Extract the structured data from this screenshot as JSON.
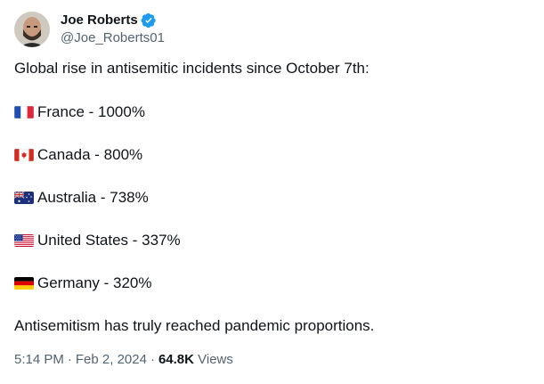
{
  "author": {
    "display_name": "Joe Roberts",
    "handle": "@Joe_Roberts01",
    "verified": true,
    "avatar_icon": "profile-photo"
  },
  "tweet": {
    "headline": "Global rise in antisemitic incidents since October 7th:",
    "items": [
      {
        "flag_icon": "france-flag-icon",
        "text": "France - 1000%"
      },
      {
        "flag_icon": "canada-flag-icon",
        "text": "Canada - 800%"
      },
      {
        "flag_icon": "australia-flag-icon",
        "text": "Australia - 738%"
      },
      {
        "flag_icon": "usa-flag-icon",
        "text": "United States - 337%"
      },
      {
        "flag_icon": "germany-flag-icon",
        "text": "Germany - 320%"
      }
    ],
    "closing": "Antisemitism has truly reached pandemic proportions."
  },
  "meta": {
    "time": "5:14 PM",
    "separator": "·",
    "date": "Feb 2, 2024",
    "views_count": "64.8K",
    "views_label": "Views"
  },
  "colors": {
    "verified_badge": "#1d9bf0",
    "secondary_text": "#536471",
    "primary_text": "#0f1419"
  }
}
